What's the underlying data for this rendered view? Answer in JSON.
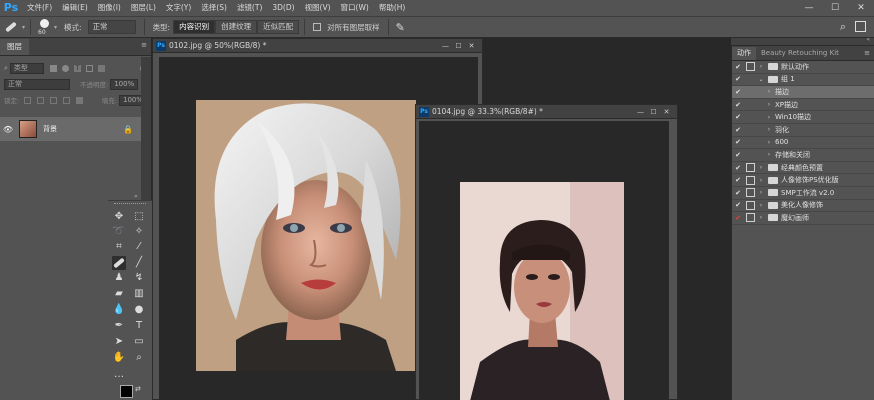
{
  "app": {
    "logo": "Ps"
  },
  "menu": [
    "文件(F)",
    "编辑(E)",
    "图像(I)",
    "图层(L)",
    "文字(Y)",
    "选择(S)",
    "滤镜(T)",
    "3D(D)",
    "视图(V)",
    "窗口(W)",
    "帮助(H)"
  ],
  "window_controls": {
    "minimize": "—",
    "maximize": "☐",
    "close": "✕"
  },
  "options": {
    "brush_size": "60",
    "mode_label": "模式:",
    "mode_value": "正常",
    "type_label": "类型:",
    "type_buttons": [
      "内容识别",
      "创建纹理",
      "近似匹配"
    ],
    "active_type": 0,
    "sample_all_label": "对所有图层取样"
  },
  "layers_panel": {
    "tab": "图层",
    "kind_placeholder": "类型",
    "blend_mode": "正常",
    "opacity_label": "不透明度:",
    "opacity_value": "100%",
    "lock_label": "锁定:",
    "fill_label": "填充:",
    "fill_value": "100%",
    "layer_name": "背景"
  },
  "documents": [
    {
      "title": "0102.jpg @ 50%(RGB/8) *"
    },
    {
      "title": "0104.jpg @ 33.3%(RGB/8#) *"
    }
  ],
  "actions_panel": {
    "tabs": [
      "动作",
      "Beauty Retouching Kit"
    ],
    "active_tab": 0,
    "items": [
      {
        "label": "默认动作",
        "level": 0,
        "type": "folder",
        "box": true,
        "expanded": false,
        "checked": true
      },
      {
        "label": "组 1",
        "level": 0,
        "type": "folder",
        "box": false,
        "expanded": true,
        "checked": true
      },
      {
        "label": "描边",
        "level": 1,
        "type": "action",
        "box": false,
        "expanded": false,
        "checked": true,
        "highlighted": true
      },
      {
        "label": "XP描边",
        "level": 1,
        "type": "action",
        "box": false,
        "expanded": false,
        "checked": true
      },
      {
        "label": "Win10描边",
        "level": 1,
        "type": "action",
        "box": false,
        "expanded": false,
        "checked": true
      },
      {
        "label": "羽化",
        "level": 1,
        "type": "action",
        "box": false,
        "expanded": false,
        "checked": true
      },
      {
        "label": "600",
        "level": 1,
        "type": "action",
        "box": false,
        "expanded": false,
        "checked": true
      },
      {
        "label": "存储和关闭",
        "level": 1,
        "type": "action",
        "box": false,
        "expanded": false,
        "checked": true
      },
      {
        "label": "经典颜色预置",
        "level": 0,
        "type": "folder",
        "box": true,
        "expanded": false,
        "checked": true
      },
      {
        "label": "人像修饰PS优化版",
        "level": 0,
        "type": "folder",
        "box": true,
        "expanded": false,
        "checked": true
      },
      {
        "label": "SMP工作流 v2.0",
        "level": 0,
        "type": "folder",
        "box": true,
        "expanded": false,
        "checked": true
      },
      {
        "label": "美化人像修饰",
        "level": 0,
        "type": "folder",
        "box": true,
        "expanded": false,
        "checked": true
      },
      {
        "label": "魔幻画师",
        "level": 0,
        "type": "folder",
        "box": true,
        "expanded": false,
        "checked": true,
        "red": true
      }
    ]
  },
  "colors": {
    "ui_dark": "#282828",
    "ui_panel": "#535353",
    "ps_blue": "#31a8ff"
  }
}
